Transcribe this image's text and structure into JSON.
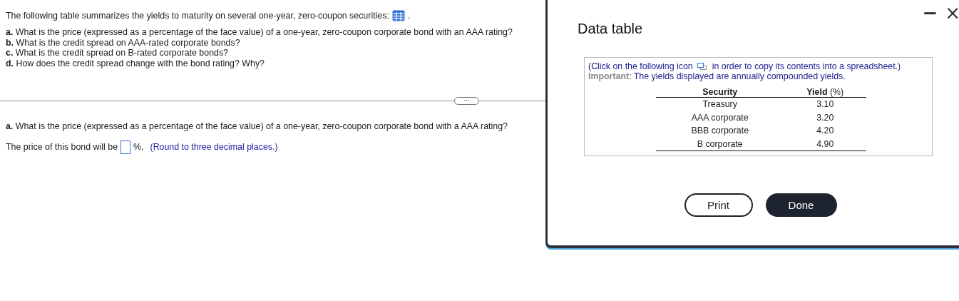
{
  "intro": "The following table summarizes the yields to maturity on several one-year, zero-coupon securities:",
  "intro_end": ".",
  "questions": [
    {
      "label": "a.",
      "text": "What is the price (expressed as a percentage of the face value) of a one-year, zero-coupon corporate bond with an AAA rating?"
    },
    {
      "label": "b.",
      "text": "What is the credit spread on AAA-rated corporate bonds?"
    },
    {
      "label": "c.",
      "text": "What is the credit spread on B-rated corporate bonds?"
    },
    {
      "label": "d.",
      "text": "How does the credit spread change with the bond rating? Why?"
    }
  ],
  "expand_button": "⋯",
  "current_question": {
    "label": "a.",
    "text": "What is the price (expressed as a percentage of the face value) of a one-year, zero-coupon corporate bond with a AAA rating?"
  },
  "answer": {
    "before": "The price of this bond will be",
    "after": "%.",
    "hint": "(Round to three decimal places.)"
  },
  "dialog": {
    "title": "Data table",
    "minimize": "−",
    "close": "×",
    "note_before": "(Click on the following icon",
    "note_after": "in order to copy its contents into a spreadsheet.)",
    "important": "**Important**: The yields displayed are annually compounded yields.",
    "columns": [
      "**Security**",
      "**Yield** (%)"
    ],
    "rows": [
      [
        "Treasury",
        "3.10"
      ],
      [
        "AAA corporate",
        "3.20"
      ],
      [
        "BBB corporate",
        "4.20"
      ],
      [
        "B corporate",
        "4.90"
      ]
    ],
    "buttons": [
      {
        "label": "Print",
        "kind": "secondary"
      },
      {
        "label": "Done",
        "kind": "primary"
      }
    ]
  }
}
